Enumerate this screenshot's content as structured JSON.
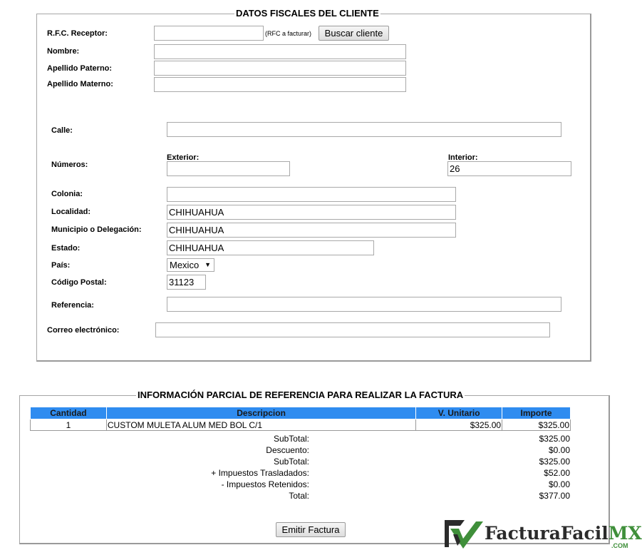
{
  "fiscal": {
    "legend": "DATOS FISCALES DEL CLIENTE",
    "rfc_label": "R.F.C. Receptor:",
    "rfc_value": "",
    "rfc_hint": "(RFC a facturar)",
    "search_button": "Buscar cliente",
    "nombre_label": "Nombre:",
    "nombre_value": "",
    "apellido_paterno_label": "Apellido Paterno:",
    "apellido_paterno_value": "",
    "apellido_materno_label": "Apellido Materno:",
    "apellido_materno_value": "",
    "calle_label": "Calle:",
    "calle_value": "",
    "numeros_label": "Números:",
    "exterior_label": "Exterior:",
    "exterior_value": "",
    "interior_label": "Interior:",
    "interior_value": "26",
    "colonia_label": "Colonia:",
    "colonia_value": "",
    "localidad_label": "Localidad:",
    "localidad_value": "CHIHUAHUA",
    "municipio_label": "Municipio o Delegación:",
    "municipio_value": "CHIHUAHUA",
    "estado_label": "Estado:",
    "estado_value": "CHIHUAHUA",
    "pais_label": "País:",
    "pais_value": "Mexico",
    "cp_label": "Código Postal:",
    "cp_value": "31123",
    "referencia_label": "Referencia:",
    "referencia_value": "",
    "correo_label": "Correo electrónico:",
    "correo_value": ""
  },
  "invoice": {
    "legend": "INFORMACIÓN PARCIAL DE REFERENCIA PARA REALIZAR LA FACTURA",
    "columns": [
      "Cantidad",
      "Descripcion",
      "V. Unitario",
      "Importe"
    ],
    "rows": [
      {
        "cantidad": "1",
        "descripcion": "CUSTOM MULETA ALUM MED BOL C/1",
        "unitario": "$325.00",
        "importe": "$325.00"
      }
    ],
    "totals": [
      {
        "label": "SubTotal:",
        "value": "$325.00"
      },
      {
        "label": "Descuento:",
        "value": "$0.00"
      },
      {
        "label": "SubTotal:",
        "value": "$325.00"
      },
      {
        "label": "+ Impuestos Trasladados:",
        "value": "$52.00"
      },
      {
        "label": "- Impuestos Retenidos:",
        "value": "$0.00"
      },
      {
        "label": "Total:",
        "value": "$377.00"
      }
    ],
    "emit_button": "Emitir Factura"
  },
  "logo": {
    "name_part1": "FacturaFacil",
    "name_part2": "MX",
    "suffix": ".COM",
    "colors": {
      "dark": "#2b2b2b",
      "green": "#3f8f3a"
    }
  },
  "colors": {
    "table_header": "#2f8cf0"
  }
}
